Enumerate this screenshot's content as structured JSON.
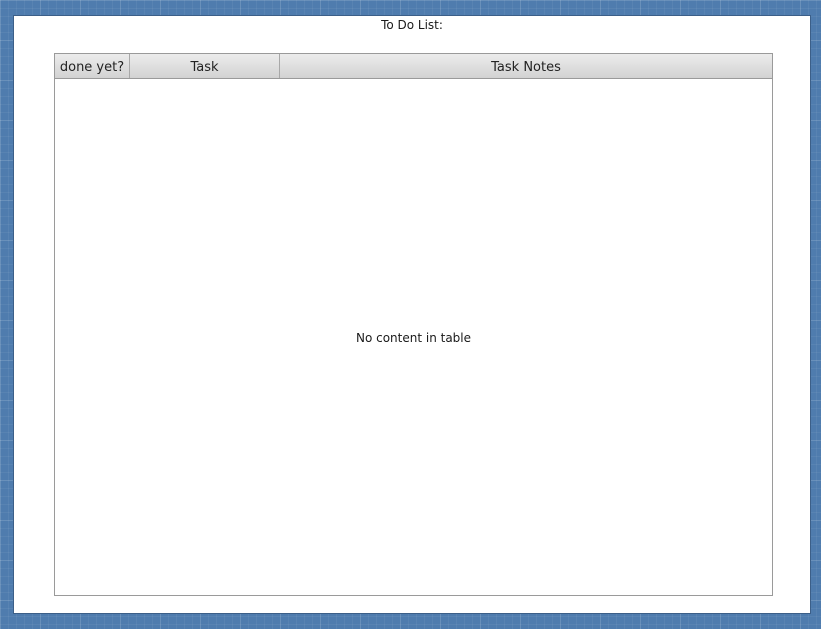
{
  "window": {
    "title": "To Do List:"
  },
  "table": {
    "columns": [
      {
        "label": "done yet?"
      },
      {
        "label": "Task"
      },
      {
        "label": "Task Notes"
      }
    ],
    "rows": [],
    "empty_message": "No content in table"
  },
  "colors": {
    "desktop_background": "#4f7cae",
    "window_background": "#ffffff",
    "header_gradient_top": "#ececec",
    "header_gradient_bottom": "#d2d2d2",
    "border": "#9a9a9a"
  }
}
